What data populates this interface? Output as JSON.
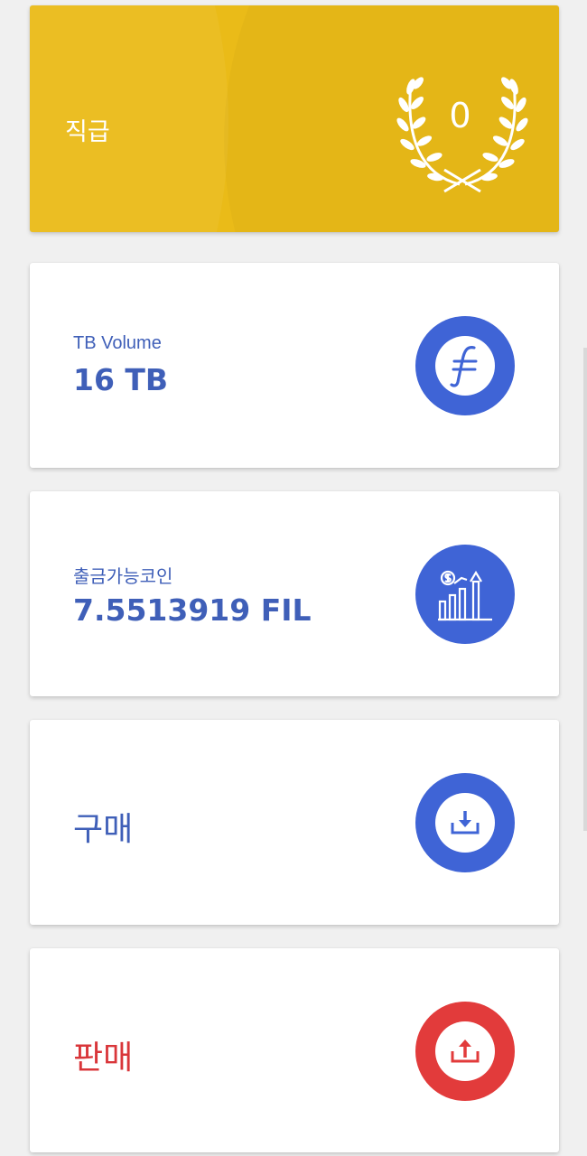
{
  "rank": {
    "label": "직급",
    "value": "0",
    "icon": "laurel-wreath-icon",
    "background": "#eabb18"
  },
  "cards": [
    {
      "label": "TB Volume",
      "value": "16 TB",
      "icon": "filecoin-icon"
    },
    {
      "label": "출금가능코인",
      "value": "7.5513919 FIL",
      "icon": "growth-chart-icon"
    }
  ],
  "actions": {
    "buy": {
      "label": "구매",
      "icon": "download-icon",
      "color": "#3f64d6"
    },
    "sell": {
      "label": "판매",
      "icon": "upload-icon",
      "color": "#e23b3b"
    }
  },
  "colors": {
    "text_blue": "#3f5fb8",
    "text_red": "#d9363a"
  }
}
